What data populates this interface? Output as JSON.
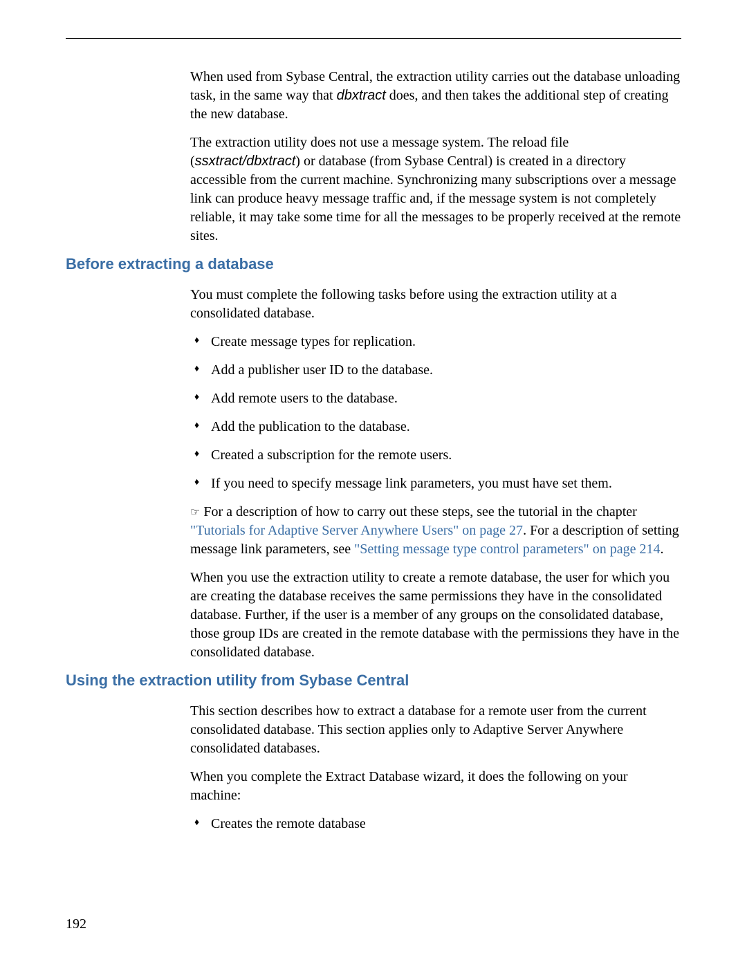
{
  "para1_part1": "When used from Sybase Central, the extraction utility carries out the database unloading task, in the same way that ",
  "para1_italic": "dbxtract",
  "para1_part2": " does, and then takes the additional step of creating the new database.",
  "para2_part1": "The extraction utility does not use a message system. The reload file (",
  "para2_italic": "ssxtract/dbxtract",
  "para2_part2": ") or database (from Sybase Central) is created in a directory accessible from the current machine. Synchronizing many subscriptions over a message link can produce heavy message traffic and, if the message system is not completely reliable, it may take some time for all the messages to be properly received at the remote sites.",
  "heading1": "Before extracting a database",
  "para3": "You must complete the following tasks before using the extraction utility at a consolidated database.",
  "list1": {
    "item1": "Create message types for replication.",
    "item2": "Add a publisher user ID to the database.",
    "item3": "Add remote users to the database.",
    "item4": "Add the publication to the database.",
    "item5": "Created a subscription for the remote users.",
    "item6": "If you need to specify message link parameters, you must have set them."
  },
  "pointer": "☞",
  "para4_part1": "For a description of how to carry out these steps, see the tutorial in the chapter ",
  "para4_link1": "\"Tutorials for Adaptive Server Anywhere Users\" on page 27",
  "para4_part2": ". For a description of setting message link parameters, see ",
  "para4_link2": "\"Setting message type control parameters\" on page 214",
  "para4_part3": ".",
  "para5": "When you use the extraction utility to create a remote database, the user for which you are creating the database receives the same permissions they have in the consolidated database. Further, if the user is a member of any groups on the consolidated database, those group IDs are created in the remote database with the permissions they have in the consolidated database.",
  "heading2": "Using the extraction utility from Sybase Central",
  "para6": "This section describes how to extract a database for a remote user from the current consolidated database. This section applies only to Adaptive Server Anywhere consolidated databases.",
  "para7": "When you complete the Extract Database wizard, it does the following on your machine:",
  "list2": {
    "item1": "Creates the remote database"
  },
  "pageNumber": "192"
}
